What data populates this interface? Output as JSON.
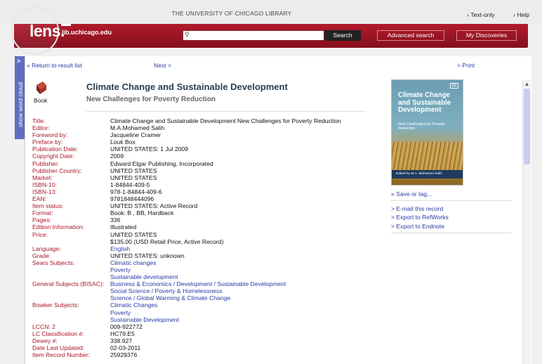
{
  "header": {
    "university": "THE UNIVERSITY OF CHICAGO LIBRARY",
    "text_only": "Text-only",
    "help": "Help",
    "logo": "lens.",
    "logo_domain": "lib.uchicago.edu",
    "search_button": "Search",
    "advanced_search": "Advanced search",
    "my_discoveries": "My Discoveries"
  },
  "sidebar": {
    "word_cloud": "show word cloud",
    "arrow": ">"
  },
  "nav": {
    "return": "« Return to result list",
    "next": "Next >",
    "print": "> Print"
  },
  "record": {
    "type": "Book",
    "title": "Climate Change and Sustainable Development",
    "subtitle": "New Challenges for Poverty Reduction",
    "fields": [
      {
        "label": "Title:",
        "values": [
          "Climate Change and Sustainable Development New Challenges for Poverty Reduction"
        ]
      },
      {
        "label": "Editor:",
        "values": [
          "M.A.Mohamed Salih"
        ]
      },
      {
        "label": "Foreword by:",
        "values": [
          "Jacqueline Cramer"
        ]
      },
      {
        "label": "Preface by:",
        "values": [
          "Louk Box"
        ]
      },
      {
        "label": "Publication Date:",
        "values": [
          "UNITED STATES: 1 Jul 2009"
        ]
      },
      {
        "label": "Copyright Date:",
        "values": [
          "2009"
        ]
      },
      {
        "label": "Publisher:",
        "values": [
          "Edward Elgar Publishing, Incorporated"
        ]
      },
      {
        "label": "Publisher Country:",
        "values": [
          "UNITED STATES"
        ]
      },
      {
        "label": "Market:",
        "values": [
          "UNITED STATES"
        ]
      },
      {
        "label": "ISBN-10:",
        "values": [
          "1-84844-409-5"
        ]
      },
      {
        "label": "ISBN-13:",
        "values": [
          "978-1-84844-409-6"
        ]
      },
      {
        "label": "EAN:",
        "values": [
          "9781848444096"
        ]
      },
      {
        "label": "Item status:",
        "values": [
          "UNITED STATES: Active Record"
        ]
      },
      {
        "label": "Format:",
        "values": [
          "Book: B , BB, Hardback"
        ]
      },
      {
        "label": "Pages:",
        "values": [
          "336"
        ]
      },
      {
        "label": "Edition Information:",
        "values": [
          "Illustrated"
        ]
      },
      {
        "label": "Price:",
        "values": [
          "UNITED STATES",
          "$135.00 (USD Retail Price, Active Record)"
        ]
      },
      {
        "label": "Language:",
        "values": [
          "English"
        ],
        "link": true
      },
      {
        "label": "Grade:",
        "values": [
          "UNITED STATES: unknown"
        ]
      },
      {
        "label": "Sears Subjects:",
        "values": [
          "Climatic changes",
          "Poverty",
          "Sustainable development"
        ],
        "link": true
      },
      {
        "label": "General Subjects (BISAC):",
        "values": [
          "Business & Economics / Development / Sustainable Development",
          "Social Science / Poverty & Homelessness",
          "Science / Global Warming & Climate Change"
        ],
        "link": true
      },
      {
        "label": "Bowker Subjects:",
        "values": [
          "Climatic Changes",
          "Poverty",
          "Sustainable Development"
        ],
        "link": true
      },
      {
        "label": "LCCN: 2",
        "values": [
          "009-922772"
        ]
      },
      {
        "label": "LC Classification #:",
        "values": [
          "HC79.E5"
        ]
      },
      {
        "label": "Dewey #:",
        "values": [
          "338.927"
        ]
      },
      {
        "label": "Date Last Updated:",
        "values": [
          "02-03-2011"
        ]
      },
      {
        "label": "Item Record Number:",
        "values": [
          "25929376"
        ]
      }
    ]
  },
  "cover": {
    "title": "Climate Change and Sustainable Development",
    "subtitle": "New Challenges for Poverty Reduction",
    "editor": "Edited by M.A. Mohamed Salih",
    "publisher_mark": "EE"
  },
  "actions": {
    "save": "» Save or tag...",
    "email": "> E-mail this record",
    "refworks": "> Export to RefWorks",
    "endnote": "> Export to Endnote"
  }
}
